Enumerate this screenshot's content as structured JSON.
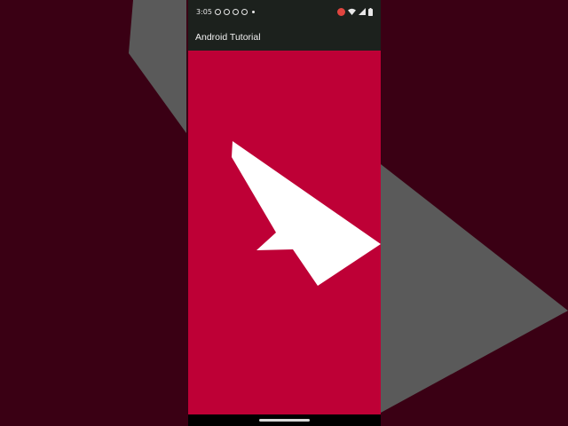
{
  "status_bar": {
    "time": "3:05",
    "left_icons": [
      "sync-icon",
      "facebook-icon",
      "messenger-icon",
      "messenger-icon",
      "more-dot-icon"
    ],
    "right_icons": [
      "screen-record-icon",
      "wifi-icon",
      "signal-icon",
      "battery-icon"
    ]
  },
  "app_bar": {
    "title": "Android Tutorial"
  },
  "colors": {
    "background": "#3a0014",
    "content": "#be0036",
    "bars": "#1c211d",
    "shape": "#ffffff",
    "blurred_shape": "#5a5a5a"
  },
  "icons": {
    "content_shape": "paper-plane-icon",
    "nav_handle": "home-gesture-handle"
  }
}
